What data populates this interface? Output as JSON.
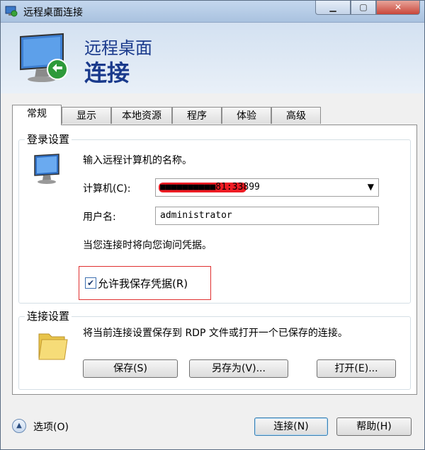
{
  "window": {
    "title": "远程桌面连接",
    "minimize_label": "▁",
    "maximize_label": "▢",
    "close_label": "✕"
  },
  "banner": {
    "line1": "远程桌面",
    "line2": "连接"
  },
  "tabs": [
    {
      "label": "常规",
      "active": true
    },
    {
      "label": "显示"
    },
    {
      "label": "本地资源"
    },
    {
      "label": "程序"
    },
    {
      "label": "体验"
    },
    {
      "label": "高级"
    }
  ],
  "login": {
    "group_label": "登录设置",
    "prompt": "输入远程计算机的名称。",
    "computer_label": "计算机(C):",
    "computer_value": "■■■■■■■■■■81:33899",
    "username_label": "用户名:",
    "username_value": "administrator",
    "credentials_note": "当您连接时将向您询问凭据。",
    "save_credentials_label": "允许我保存凭据(R)",
    "save_credentials_checked": true
  },
  "connection": {
    "group_label": "连接设置",
    "description": "将当前连接设置保存到 RDP 文件或打开一个已保存的连接。",
    "save_label": "保存(S)",
    "save_as_label": "另存为(V)...",
    "open_label": "打开(E)..."
  },
  "footer": {
    "options_label": "选项(O)",
    "connect_label": "连接(N)",
    "help_label": "帮助(H)"
  },
  "icons": {
    "app": "remote-desktop-icon",
    "banner": "monitor-icon",
    "login": "computer-icon",
    "connection": "folder-icon",
    "options": "chevron-up-icon"
  }
}
